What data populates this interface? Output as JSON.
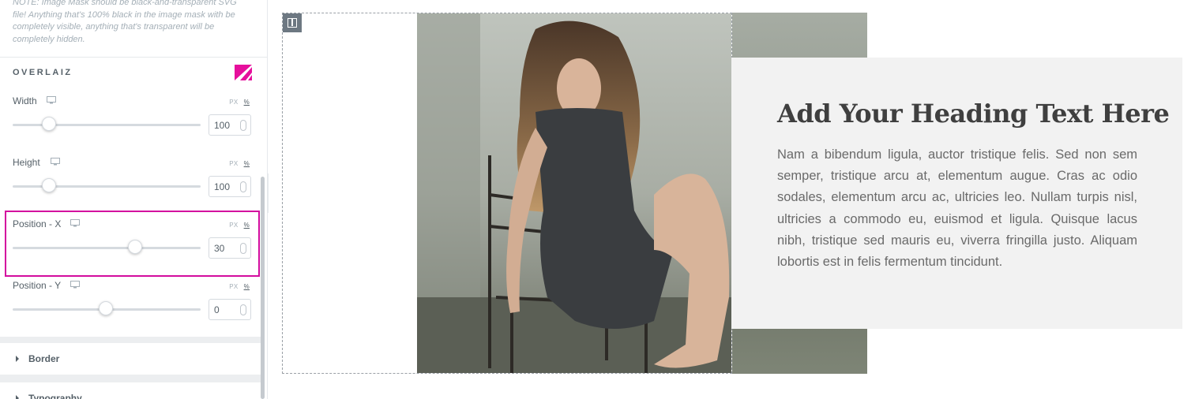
{
  "panel": {
    "note": "NOTE: Image Mask should be black-and-transparent SVG file! Anything that's 100% black in the image mask with be completely visible, anything that's transparent will be completely hidden.",
    "section_title": "OVERLAIZ",
    "controls": [
      {
        "label": "Width",
        "unit_px": "PX",
        "unit_pct": "%",
        "value": "100",
        "slider_percent": 0.19
      },
      {
        "label": "Height",
        "unit_px": "PX",
        "unit_pct": "%",
        "value": "100",
        "slider_percent": 0.19
      },
      {
        "label": "Position - X",
        "unit_px": "PX",
        "unit_pct": "%",
        "value": "30",
        "slider_percent": 0.65
      },
      {
        "label": "Position - Y",
        "unit_px": "PX",
        "unit_pct": "%",
        "value": "0",
        "slider_percent": 0.5
      }
    ],
    "sections": [
      {
        "label": "Border"
      },
      {
        "label": "Typography"
      }
    ],
    "highlight_color": "#d30c9e"
  },
  "canvas": {
    "heading": "Add Your Heading Text Here",
    "paragraph": "Nam a bibendum ligula, auctor tristique felis. Sed non sem semper, tristique arcu at, elementum augue. Cras ac odio sodales, elementum arcu ac, ultricies leo. Nullam turpis nisl, ultricies a commodo eu, euismod et ligula. Quisque lacus nibh, tristique sed mauris eu, viverra fringilla justo. Aliquam lobortis est in felis fermentum tincidunt."
  },
  "icons": {
    "brand": "overlaiz-logo-icon",
    "device": "desktop-icon",
    "collapse": "chevron-left-icon",
    "column_handle": "column-icon",
    "section_caret": "caret-right-icon"
  },
  "colors": {
    "accent": "#d30c9e",
    "text_box_bg": "#f2f2f2"
  }
}
